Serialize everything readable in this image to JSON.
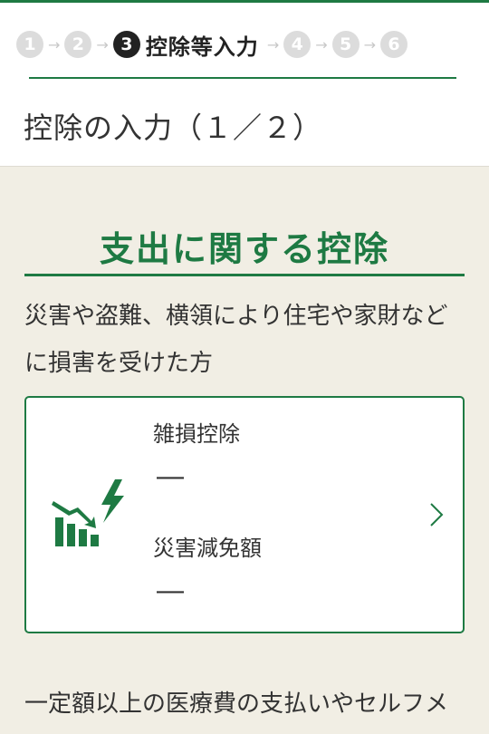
{
  "stepper": {
    "steps": [
      "1",
      "2",
      "3",
      "4",
      "5",
      "6"
    ],
    "active_index": 2,
    "active_label": "控除等入力",
    "arrow": "→"
  },
  "page": {
    "title": "控除の入力（１／２）"
  },
  "section": {
    "title": "支出に関する控除",
    "description": "災害や盗難、横領により住宅や家財などに損害を受けた方"
  },
  "card": {
    "icon": "disaster-loss-chart-icon",
    "items": [
      {
        "label": "雑損控除",
        "value": "―"
      },
      {
        "label": "災害減免額",
        "value": "―"
      }
    ],
    "chevron": "chevron-right-icon"
  },
  "next_section": {
    "description": "一定額以上の医療費の支払いやセルフメ"
  },
  "colors": {
    "accent": "#1e7a43",
    "background": "#f1eee4",
    "inactive_step": "#dcdcdc"
  }
}
